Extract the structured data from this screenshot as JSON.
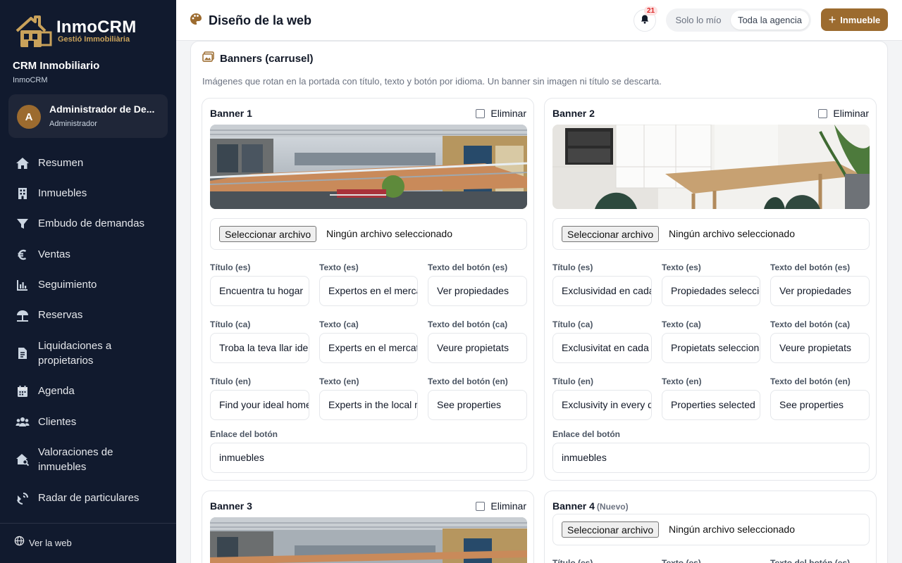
{
  "app": {
    "logo_name": "InmoCRM",
    "logo_sub": "Gestió Immobiliària",
    "title": "CRM Inmobiliario",
    "subtitle": "InmoCRM"
  },
  "user": {
    "initial": "A",
    "name": "Administrador de De...",
    "role": "Administrador"
  },
  "nav": [
    {
      "label": "Resumen",
      "icon": "home-icon"
    },
    {
      "label": "Inmuebles",
      "icon": "building-icon"
    },
    {
      "label": "Embudo de demandas",
      "icon": "funnel-icon"
    },
    {
      "label": "Ventas",
      "icon": "euro-icon"
    },
    {
      "label": "Seguimiento",
      "icon": "chart-icon"
    },
    {
      "label": "Reservas",
      "icon": "umbrella-icon"
    },
    {
      "label": "Liquidaciones a propietarios",
      "icon": "invoice-icon"
    },
    {
      "label": "Agenda",
      "icon": "calendar-icon"
    },
    {
      "label": "Clientes",
      "icon": "users-icon"
    },
    {
      "label": "Valoraciones de inmuebles",
      "icon": "house-search-icon"
    },
    {
      "label": "Radar de particulares",
      "icon": "radar-icon"
    }
  ],
  "footer_link": "Ver la web",
  "header": {
    "title": "Diseño de la web",
    "notifications": "21",
    "scope_mine": "Solo lo mío",
    "scope_all": "Toda la agencia",
    "add_label": "Inmueble"
  },
  "section": {
    "title": "Banners (carrusel)",
    "description": "Imágenes que rotan en la portada con título, texto y botón por idioma. Un banner sin imagen ni título se descarta."
  },
  "labels": {
    "delete": "Eliminar",
    "file_button": "Seleccionar archivo",
    "file_status": "Ningún archivo seleccionado",
    "title_es": "Título (es)",
    "text_es": "Texto (es)",
    "btn_es": "Texto del botón (es)",
    "title_ca": "Título (ca)",
    "text_ca": "Texto (ca)",
    "btn_ca": "Texto del botón (ca)",
    "title_en": "Título (en)",
    "text_en": "Texto (en)",
    "btn_en": "Texto del botón (en)",
    "link": "Enlace del botón",
    "new_tag": "(Nuevo)"
  },
  "banners": [
    {
      "title": "Banner 1",
      "image": "shopping-mall-photo",
      "es": {
        "title": "Encuentra tu hogar",
        "text": "Expertos en el mercado",
        "button": "Ver propiedades"
      },
      "ca": {
        "title": "Troba la teva llar ideal",
        "text": "Experts en el mercat",
        "button": "Veure propietats"
      },
      "en": {
        "title": "Find your ideal home",
        "text": "Experts in the local market",
        "button": "See properties"
      },
      "link": "inmuebles"
    },
    {
      "title": "Banner 2",
      "image": "kitchen-dining-photo",
      "es": {
        "title": "Exclusividad en cada detalle",
        "text": "Propiedades seleccionadas",
        "button": "Ver propiedades"
      },
      "ca": {
        "title": "Exclusivitat en cada detall",
        "text": "Propietats seleccionades",
        "button": "Veure propietats"
      },
      "en": {
        "title": "Exclusivity in every detail",
        "text": "Properties selected",
        "button": "See properties"
      },
      "link": "inmuebles"
    },
    {
      "title": "Banner 3",
      "image": "shopping-mall-photo"
    },
    {
      "title": "Banner 4",
      "is_new": true
    }
  ]
}
